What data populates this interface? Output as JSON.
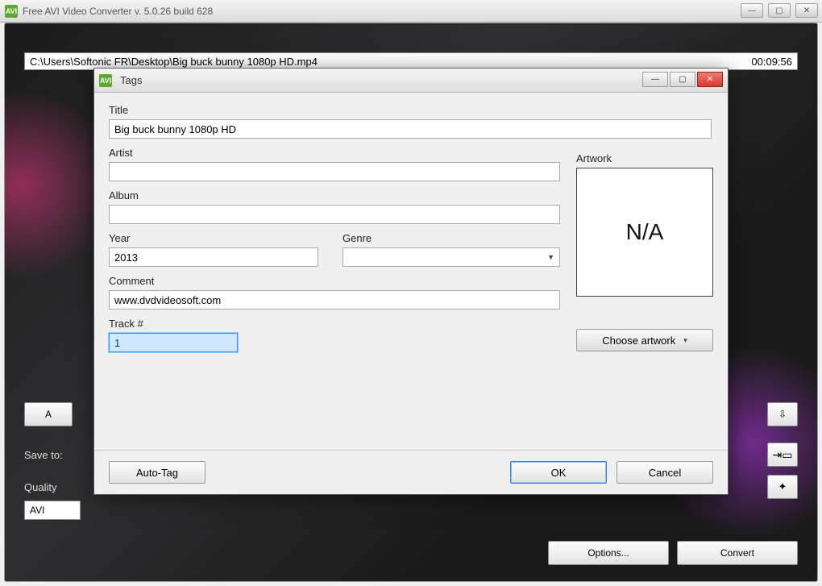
{
  "main_window": {
    "title": "Free AVI Video Converter  v. 5.0.26 build 628",
    "path": "C:\\Users\\Softonic FR\\Desktop\\Big buck bunny 1080p HD.mp4",
    "duration": "00:09:56",
    "add_button_label": "A",
    "save_to_label": "Save to:",
    "quality_label": "Quality",
    "format_value": "AVI",
    "options_label": "Options...",
    "convert_label": "Convert"
  },
  "dialog": {
    "title": "Tags",
    "fields": {
      "title_label": "Title",
      "title_value": "Big buck bunny 1080p HD",
      "artist_label": "Artist",
      "artist_value": "",
      "album_label": "Album",
      "album_value": "",
      "year_label": "Year",
      "year_value": "2013",
      "genre_label": "Genre",
      "genre_value": "",
      "comment_label": "Comment",
      "comment_value": "www.dvdvideosoft.com",
      "track_label": "Track #",
      "track_value": "1"
    },
    "artwork": {
      "label": "Artwork",
      "placeholder": "N/A",
      "choose_label": "Choose artwork"
    },
    "buttons": {
      "autotag": "Auto-Tag",
      "ok": "OK",
      "cancel": "Cancel"
    }
  }
}
